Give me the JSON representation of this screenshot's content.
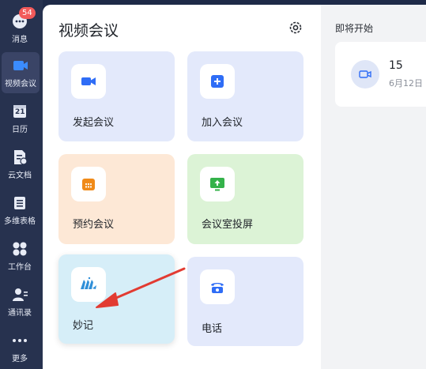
{
  "nav": {
    "badge": "54",
    "items": [
      {
        "label": "消息"
      },
      {
        "label": "视频会议"
      },
      {
        "label": "日历"
      },
      {
        "label": "云文档"
      },
      {
        "label": "多维表格"
      },
      {
        "label": "工作台"
      },
      {
        "label": "通讯录"
      },
      {
        "label": "更多"
      }
    ],
    "calendar_day": "21"
  },
  "panel": {
    "title": "视频会议",
    "tiles": [
      {
        "label": "发起会议",
        "color": "#e3e9fb",
        "icon_color": "#2f6df6"
      },
      {
        "label": "加入会议",
        "color": "#e3e9fb",
        "icon_color": "#2f6df6"
      },
      {
        "label": "预约会议",
        "color": "#fde8d6",
        "icon_color": "#f08a18"
      },
      {
        "label": "会议室投屏",
        "color": "#dcf3d6",
        "icon_color": "#34b24a"
      },
      {
        "label": "妙记",
        "color": "#d6eef8",
        "icon_color": "#2f8fd8"
      },
      {
        "label": "电话",
        "color": "#e3e9fb",
        "icon_color": "#2f6df6"
      }
    ]
  },
  "upcoming": {
    "title": "即将开始",
    "meeting_number": "15",
    "meeting_date": "6月12日"
  },
  "annotation": {
    "arrow_color": "#e23b32"
  }
}
